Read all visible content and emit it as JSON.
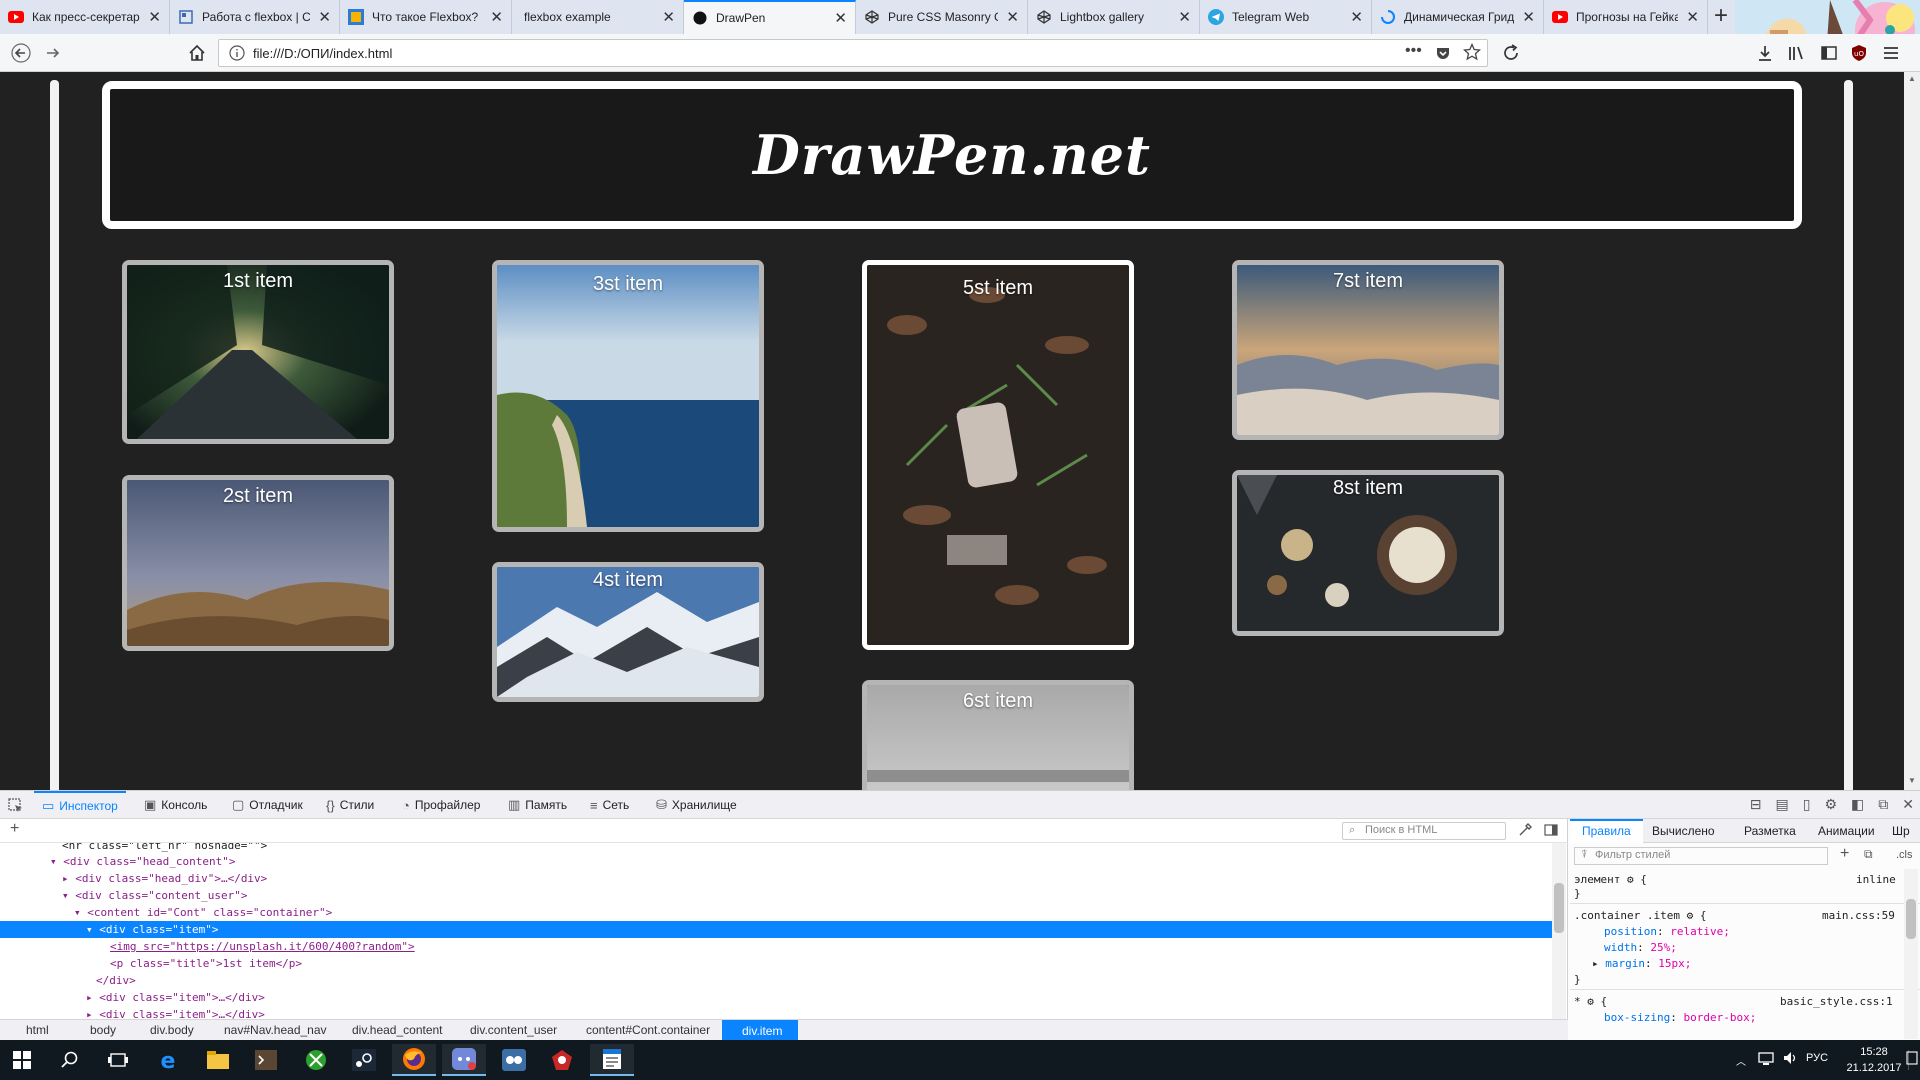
{
  "browser": {
    "tabs": [
      {
        "title": "Как пресс-секретарь",
        "favicon": "youtube-icon",
        "active": false
      },
      {
        "title": "Работа с flexbox | CSS",
        "favicon": "page-icon",
        "active": false
      },
      {
        "title": "Что такое Flexbox? Оп",
        "favicon": "html-academy-icon",
        "active": false
      },
      {
        "title": "flexbox example",
        "favicon": "",
        "active": false
      },
      {
        "title": "DrawPen",
        "favicon": "drawpen-icon",
        "active": true
      },
      {
        "title": "Pure CSS Masonry Ga",
        "favicon": "codepen-icon",
        "active": false
      },
      {
        "title": "Lightbox gallery",
        "favicon": "codepen-icon",
        "active": false
      },
      {
        "title": "Telegram Web",
        "favicon": "telegram-icon",
        "active": false
      },
      {
        "title": "Динамическая Грид",
        "favicon": "loading-icon",
        "active": false
      },
      {
        "title": "Прогнозы на Гейка",
        "favicon": "youtube-icon",
        "active": false
      }
    ],
    "url": "file:///D:/ОПИ/index.html",
    "colors": {
      "accent": "#0a84ff",
      "youtube": "#ff0000",
      "telegram": "#2ca5e0"
    }
  },
  "webpage": {
    "site_title": "DrawPen.net",
    "items": [
      {
        "title": "1st item",
        "image": "forest-road"
      },
      {
        "title": "2st item",
        "image": "desert-hills"
      },
      {
        "title": "3st item",
        "image": "coastal-cliffs"
      },
      {
        "title": "4st item",
        "image": "snowy-mountains"
      },
      {
        "title": "5st item",
        "image": "leaves-ground"
      },
      {
        "title": "6st item",
        "image": "grey-fog"
      },
      {
        "title": "7st item",
        "image": "clouds-sunset"
      },
      {
        "title": "8st item",
        "image": "food-table"
      }
    ],
    "colors": {
      "background": "#212121",
      "border": "#ffffff",
      "card_border": "#b5b5b5"
    }
  },
  "devtools": {
    "tabs": [
      {
        "label": "Инспектор",
        "icon": "inspector-icon",
        "active": true
      },
      {
        "label": "Консоль",
        "icon": "console-icon",
        "active": false
      },
      {
        "label": "Отладчик",
        "icon": "debugger-icon",
        "active": false
      },
      {
        "label": "Стили",
        "icon": "braces-icon",
        "active": false
      },
      {
        "label": "Профайлер",
        "icon": "profiler-icon",
        "active": false
      },
      {
        "label": "Память",
        "icon": "memory-icon",
        "active": false
      },
      {
        "label": "Сеть",
        "icon": "network-icon",
        "active": false
      },
      {
        "label": "Хранилище",
        "icon": "storage-icon",
        "active": false
      }
    ],
    "search_placeholder": "Поиск в HTML",
    "markup": [
      "<hr class=\"left_hr\" noshade=\"\">",
      "<div class=\"head_content\">",
      "<div class=\"head_div\">…</div>",
      "<div class=\"content_user\">",
      "<content id=\"Cont\" class=\"container\">",
      "<div class=\"item\">",
      "<img src=\"https://unsplash.it/600/400?random\">",
      "<p class=\"title\">1st item</p>",
      "</div>",
      "<div class=\"item\">…</div>",
      "<div class=\"item\">…</div>"
    ],
    "breadcrumbs": [
      "html",
      "body",
      "div.body",
      "nav#Nav.head_nav",
      "div.head_content",
      "div.content_user",
      "content#Cont.container",
      "div.item"
    ],
    "rules_tabs": [
      "Правила",
      "Вычислено",
      "Разметка",
      "Анимации",
      "Шр"
    ],
    "rules_filter_placeholder": "Фильтр стилей",
    "rules_cls_label": ".cls",
    "rules": {
      "element_selector": "элемент",
      "element_open": "{",
      "element_close": "}",
      "element_source": "inline",
      "item_selector": ".container .item",
      "item_source": "main.css:59",
      "item_props": [
        {
          "name": "position",
          "value": "relative;"
        },
        {
          "name": "width",
          "value": "25%;"
        },
        {
          "name": "margin",
          "value": "15px;"
        }
      ],
      "star_selector": "*",
      "star_source": "basic_style.css:1",
      "star_props": [
        {
          "name": "box-sizing",
          "value": "border-box;"
        }
      ]
    }
  },
  "taskbar": {
    "icons": [
      "windows-start-icon",
      "search-icon",
      "task-view-icon",
      "edge-icon",
      "file-explorer-icon",
      "terminal-icon",
      "xbox-icon",
      "steam-icon",
      "firefox-icon",
      "discord-icon",
      "game-icon",
      "red-app-icon",
      "notes-icon"
    ],
    "language": "РУС",
    "time": "15:28",
    "date": "21.12.2017"
  }
}
